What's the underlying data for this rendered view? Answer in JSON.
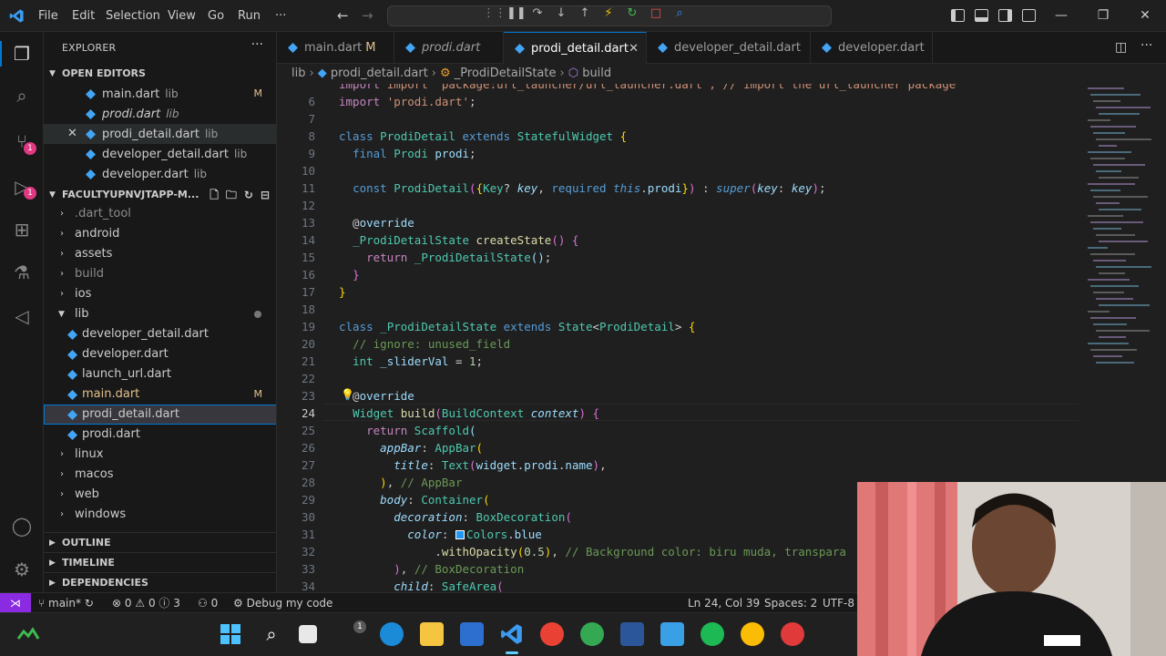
{
  "titlebar": {
    "menu": [
      "File",
      "Edit",
      "Selection",
      "View",
      "Go",
      "Run",
      "···"
    ]
  },
  "sidebar": {
    "title": "EXPLORER",
    "open_editors_label": "OPEN EDITORS",
    "open_editors": [
      {
        "name": "main.dart",
        "desc": "lib",
        "mod": "M"
      },
      {
        "name": "prodi.dart",
        "desc": "lib",
        "mod": ""
      },
      {
        "name": "prodi_detail.dart",
        "desc": "lib",
        "mod": ""
      },
      {
        "name": "developer_detail.dart",
        "desc": "lib",
        "mod": ""
      },
      {
        "name": "developer.dart",
        "desc": "lib",
        "mod": ""
      }
    ],
    "project_label": "FACULTYUPNVJTAPP-M...",
    "tree": [
      {
        "name": ".dart_tool"
      },
      {
        "name": "android"
      },
      {
        "name": "assets"
      },
      {
        "name": "build"
      },
      {
        "name": "ios"
      },
      {
        "name": "lib"
      },
      {
        "name": "developer_detail.dart"
      },
      {
        "name": "developer.dart"
      },
      {
        "name": "launch_url.dart"
      },
      {
        "name": "main.dart",
        "mod": "M"
      },
      {
        "name": "prodi_detail.dart"
      },
      {
        "name": "prodi.dart"
      },
      {
        "name": "linux"
      },
      {
        "name": "macos"
      },
      {
        "name": "web"
      },
      {
        "name": "windows"
      }
    ],
    "outline_label": "OUTLINE",
    "timeline_label": "TIMELINE",
    "dependencies_label": "DEPENDENCIES"
  },
  "tabs": [
    {
      "label": "main.dart",
      "mod": "M"
    },
    {
      "label": "prodi.dart"
    },
    {
      "label": "prodi_detail.dart",
      "close": "✕"
    },
    {
      "label": "developer_detail.dart"
    },
    {
      "label": "developer.dart"
    }
  ],
  "breadcrumb": {
    "parts": [
      "lib",
      "prodi_detail.dart",
      "_ProdiDetailState",
      "build"
    ],
    "sep": "›"
  },
  "editor": {
    "line_numbers": [
      "6",
      "7",
      "8",
      "9",
      "10",
      "11",
      "12",
      "13",
      "14",
      "15",
      "16",
      "17",
      "18",
      "19",
      "20",
      "21",
      "22",
      "23",
      "24",
      "25",
      "26",
      "27",
      "28",
      "29",
      "30",
      "31",
      "32",
      "33",
      "34"
    ],
    "top_partial": "import 'package:url_launcher/url_launcher.dart'; // import the url_launcher package",
    "comment_ignore": "// ignore: unused_field",
    "comment_appbar": "// AppBar",
    "comment_bg": "// Background color: biru muda, transpara",
    "comment_boxdec": "// BoxDecoration"
  },
  "statusbar": {
    "branch": "main*",
    "errors": "0",
    "warnings": "0",
    "infos": "3",
    "ports": "0",
    "debug": "Debug my code",
    "position": "Ln 24, Col 39",
    "spaces": "Spaces: 2",
    "encoding": "UTF-8"
  },
  "taskbar": {
    "badge": "1"
  },
  "colors": {
    "accent": "#0078d4",
    "remote": "#8a2be2",
    "badge": "#e03882",
    "dart": "#42a5f5"
  }
}
